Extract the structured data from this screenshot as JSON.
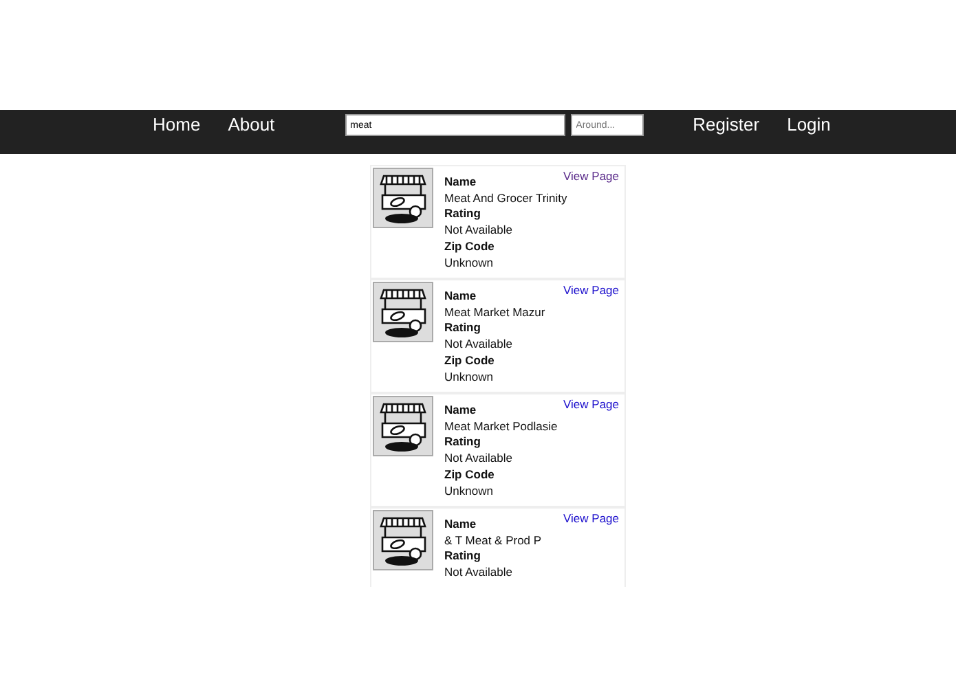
{
  "nav": {
    "left_links": [
      "Home",
      "About"
    ],
    "search": {
      "value": "meat"
    },
    "location": {
      "placeholder": "Around..."
    },
    "right_links": [
      "Register",
      "Login"
    ]
  },
  "results": [
    {
      "link": {
        "label": "View Page",
        "visited": true
      },
      "fields": [
        {
          "label": "Name",
          "value": "Meat And Grocer Trinity"
        },
        {
          "label": "Rating",
          "value": "Not Available"
        },
        {
          "label": "Zip Code",
          "value": "Unknown"
        }
      ]
    },
    {
      "link": {
        "label": "View Page",
        "visited": false
      },
      "fields": [
        {
          "label": "Name",
          "value": "Meat Market Mazur"
        },
        {
          "label": "Rating",
          "value": "Not Available"
        },
        {
          "label": "Zip Code",
          "value": "Unknown"
        }
      ]
    },
    {
      "link": {
        "label": "View Page",
        "visited": false
      },
      "fields": [
        {
          "label": "Name",
          "value": "Meat Market Podlasie"
        },
        {
          "label": "Rating",
          "value": "Not Available"
        },
        {
          "label": "Zip Code",
          "value": "Unknown"
        }
      ]
    },
    {
      "link": {
        "label": "View Page",
        "visited": false
      },
      "fields": [
        {
          "label": "Name",
          "value": "& T Meat & Prod P"
        },
        {
          "label": "Rating",
          "value": "Not Available"
        }
      ]
    }
  ]
}
